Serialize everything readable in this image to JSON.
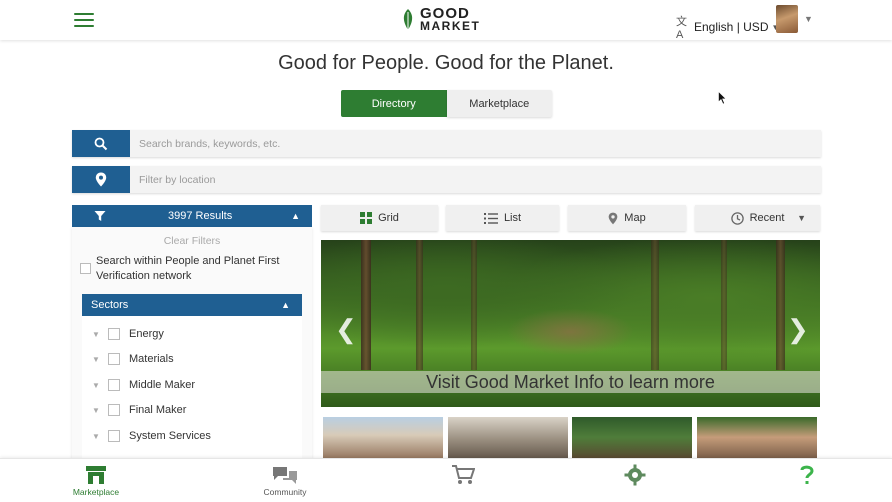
{
  "header": {
    "logo_line1": "GOOD",
    "logo_line2": "MARKET",
    "language_label": "English | USD"
  },
  "tagline": "Good for People. Good for the Planet.",
  "toggle": {
    "directory": "Directory",
    "marketplace": "Marketplace"
  },
  "search": {
    "keyword_placeholder": "Search brands, keywords, etc.",
    "location_placeholder": "Filter by location"
  },
  "filters": {
    "results": "3997 Results",
    "clear": "Clear Filters",
    "pp_label": "Search within People and Planet First Verification network",
    "sectors_title": "Sectors",
    "sectors": [
      "Energy",
      "Materials",
      "Middle Maker",
      "Final Maker",
      "System Services"
    ]
  },
  "views": {
    "grid": "Grid",
    "list": "List",
    "map": "Map",
    "sort": "Recent"
  },
  "carousel": {
    "banner": "Visit Good Market Info to learn more"
  },
  "bottom_nav": {
    "marketplace": "Marketplace",
    "community": "Community"
  },
  "colors": {
    "primary_green": "#2e7d32",
    "primary_blue": "#1f5f92"
  },
  "icons": [
    "menu-icon",
    "translate-icon",
    "search-icon",
    "location-pin-icon",
    "filter-icon",
    "grid-icon",
    "list-icon",
    "map-pin-icon",
    "clock-icon",
    "store-icon",
    "chat-icon",
    "cart-icon",
    "gear-icon",
    "help-icon"
  ]
}
